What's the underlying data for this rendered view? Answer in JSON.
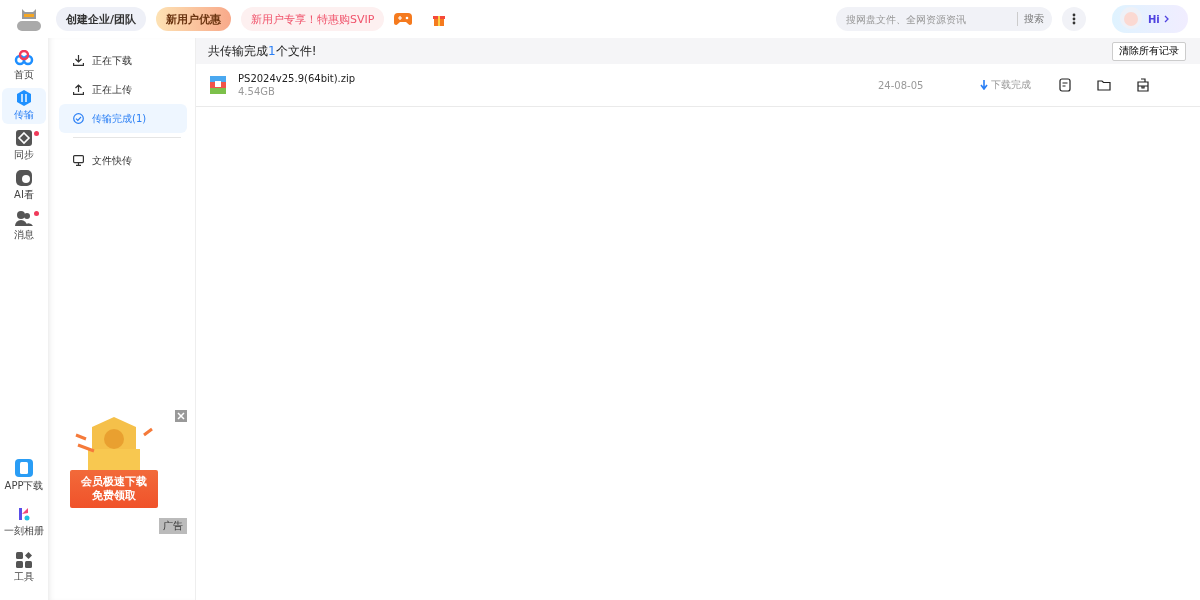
{
  "topbar": {
    "buttons": [
      {
        "kind": "team",
        "label": "创建企业/团队"
      },
      {
        "kind": "promo",
        "label": "新用户优惠"
      },
      {
        "kind": "svip",
        "label": "新用户专享！特惠购SVIP"
      }
    ],
    "search": {
      "placeholder": "搜网盘文件、全网资源资讯",
      "button": "搜索"
    },
    "profile": {
      "greeting": "Hi"
    }
  },
  "rail": {
    "top": [
      {
        "kind": "home",
        "label": "首页",
        "selected": false,
        "dot": false
      },
      {
        "kind": "transfer",
        "label": "传输",
        "selected": true,
        "dot": false
      },
      {
        "kind": "sync",
        "label": "同步",
        "selected": false,
        "dot": true
      },
      {
        "kind": "ai",
        "label": "AI看",
        "selected": false,
        "dot": false
      },
      {
        "kind": "message",
        "label": "消息",
        "selected": false,
        "dot": true
      }
    ],
    "bottom": [
      {
        "kind": "phone",
        "label": "APP下载"
      },
      {
        "kind": "album",
        "label": "一刻相册"
      },
      {
        "kind": "tools",
        "label": "工具"
      }
    ]
  },
  "submenu": [
    {
      "kind": "download",
      "label": "正在下载",
      "selected": false
    },
    {
      "kind": "upload",
      "label": "正在上传",
      "selected": false
    },
    {
      "kind": "done",
      "label": "传输完成(1)",
      "selected": true
    },
    {
      "kind": "quick",
      "label": "文件快传",
      "selected": false
    }
  ],
  "ad": {
    "lines": [
      "会员极速下载",
      "免费领取"
    ],
    "tag": "广告"
  },
  "main": {
    "summary": "共传输完成**1**个文件!",
    "clear_button": "清除所有记录",
    "files": [
      {
        "name": "PS2024v25.9(64bit).zip",
        "size": "4.54GB",
        "date": "24-08-05",
        "status": "下载完成"
      }
    ]
  }
}
